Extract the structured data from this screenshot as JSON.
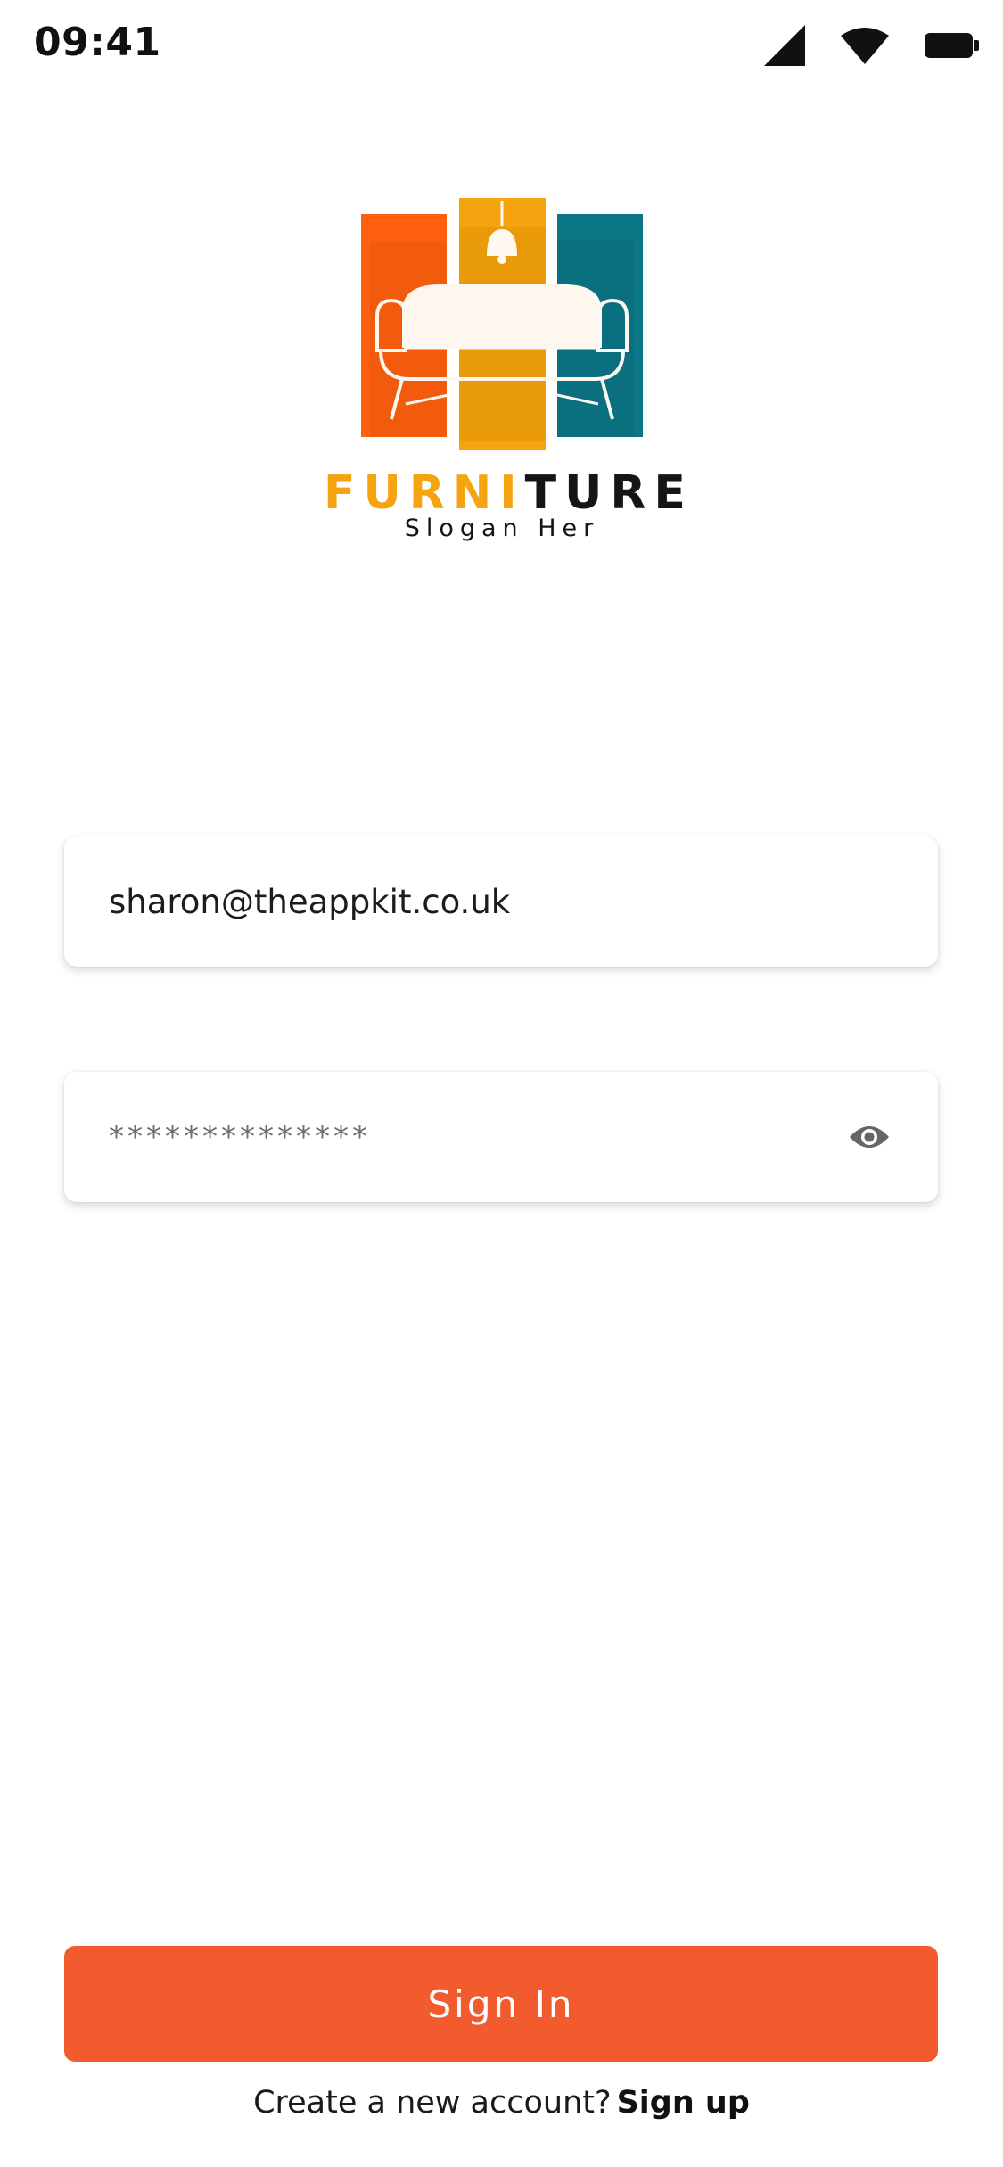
{
  "status_bar": {
    "time": "09:41",
    "icons": [
      "cellular-signal-icon",
      "wifi-icon",
      "battery-icon"
    ]
  },
  "logo": {
    "word_part_1": "FURNI",
    "word_part_2": "TURE",
    "slogan": "Slogan Her",
    "colors": {
      "orange": "#ff5f0f",
      "amber": "#f5a30f",
      "teal": "#0b7686"
    }
  },
  "form": {
    "email_value": "sharon@theappkit.co.uk",
    "password_value": "**************",
    "password_toggle_icon": "eye-icon"
  },
  "actions": {
    "signin_label": "Sign In",
    "signup_prompt": "Create a new account?",
    "signup_link": "Sign up"
  },
  "colors": {
    "accent": "#f25b2d",
    "background": "#ffffff"
  }
}
